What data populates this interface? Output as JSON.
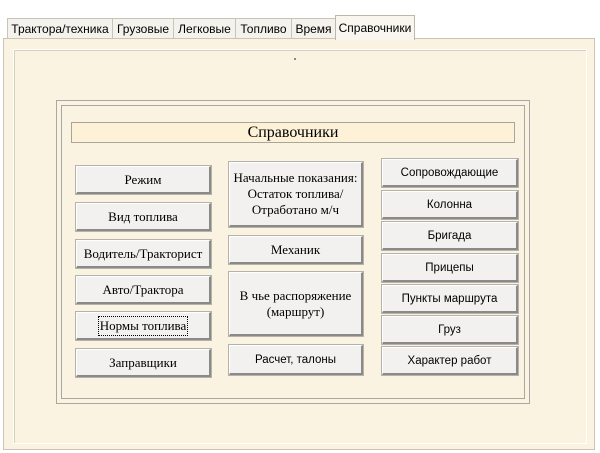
{
  "tabs": [
    {
      "label": "Трактора/техника"
    },
    {
      "label": "Грузовые"
    },
    {
      "label": "Легковые"
    },
    {
      "label": "Топливо"
    },
    {
      "label": "Время"
    },
    {
      "label": "Справочники"
    }
  ],
  "active_tab": "Справочники",
  "panel": {
    "title": "Справочники",
    "dot": "."
  },
  "column1": [
    "Режим",
    "Вид топлива",
    "Водитель/Тракторист",
    "Авто/Трактора",
    "Нормы топлива",
    "Заправщики"
  ],
  "column2": [
    "Начальные показания:\nОстаток топлива/\nОтработано м/ч",
    "Механик",
    "В чье распоряжение\n(маршрут)",
    "Расчет, талоны"
  ],
  "column3": [
    "Сопровождающие",
    "Колонна",
    "Бригада",
    "Прицепы",
    "Пункты маршрута",
    "Груз",
    "Характер работ"
  ],
  "colors": {
    "panel_bg": "#fbf3e1",
    "title_bg": "#fdf1d8",
    "button_bg": "#f2f1ef"
  }
}
